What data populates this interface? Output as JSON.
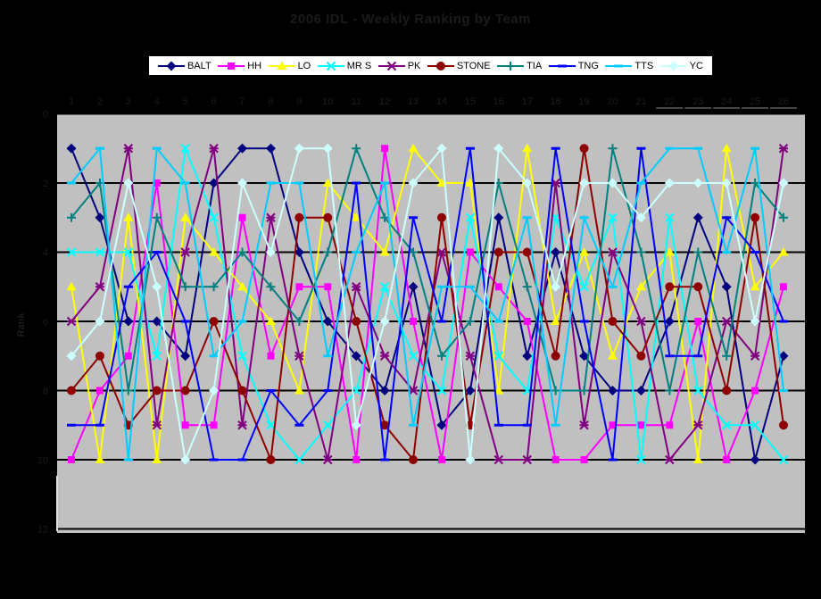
{
  "chart_data": {
    "type": "line",
    "title": "2006 IDL - Weekly Ranking by Team",
    "ylabel": "Rank",
    "x_categories": [
      "1",
      "2",
      "3",
      "4",
      "5",
      "6",
      "7",
      "8",
      "9",
      "10",
      "11",
      "12",
      "13",
      "14",
      "15",
      "16",
      "17",
      "18",
      "19",
      "20",
      "21",
      "22",
      "23",
      "24",
      "25",
      "26"
    ],
    "y_ticks": [
      "0",
      "2",
      "4",
      "6",
      "8",
      "10",
      "12"
    ],
    "ylim": [
      0,
      12
    ],
    "y_axis_reversed": true,
    "grid": true,
    "legend_position": "top",
    "plot_bg_color": "#C0C0C0",
    "gridline_color": "#000000",
    "axis_text_color": "#1b1b1b",
    "series": [
      {
        "name": "BALT",
        "color": "#000080",
        "marker": "diamond",
        "values": [
          1,
          3,
          6,
          6,
          7,
          2,
          1,
          1,
          4,
          6,
          7,
          8,
          5,
          9,
          8,
          3,
          7,
          4,
          7,
          8,
          8,
          6,
          3,
          5,
          10,
          7
        ]
      },
      {
        "name": "HH",
        "color": "#FF00FF",
        "marker": "square",
        "values": [
          10,
          8,
          7,
          2,
          9,
          9,
          3,
          7,
          5,
          5,
          10,
          1,
          6,
          10,
          4,
          5,
          6,
          10,
          10,
          9,
          9,
          9,
          6,
          10,
          8,
          5
        ]
      },
      {
        "name": "LO",
        "color": "#FFFF00",
        "marker": "triangle",
        "values": [
          5,
          10,
          3,
          10,
          3,
          4,
          5,
          6,
          8,
          2,
          3,
          4,
          1,
          2,
          2,
          8,
          1,
          6,
          4,
          7,
          5,
          4,
          10,
          1,
          5,
          4
        ]
      },
      {
        "name": "MR S",
        "color": "#00FFFF",
        "marker": "x",
        "values": [
          4,
          4,
          4,
          7,
          1,
          3,
          7,
          9,
          10,
          9,
          8,
          5,
          7,
          8,
          3,
          7,
          8,
          3,
          5,
          3,
          10,
          3,
          8,
          9,
          9,
          10
        ]
      },
      {
        "name": "PK",
        "color": "#800080",
        "marker": "asterisk",
        "values": [
          6,
          5,
          1,
          9,
          4,
          1,
          9,
          3,
          7,
          10,
          5,
          7,
          8,
          4,
          7,
          10,
          10,
          2,
          9,
          4,
          6,
          10,
          9,
          6,
          7,
          1
        ]
      },
      {
        "name": "STONE",
        "color": "#8E0000",
        "marker": "circle",
        "values": [
          8,
          7,
          9,
          8,
          8,
          6,
          8,
          10,
          3,
          3,
          6,
          9,
          10,
          3,
          9,
          4,
          4,
          7,
          1,
          6,
          7,
          5,
          5,
          8,
          3,
          9
        ]
      },
      {
        "name": "TIA",
        "color": "#008080",
        "marker": "plus",
        "values": [
          3,
          2,
          8,
          3,
          5,
          5,
          4,
          5,
          6,
          4,
          1,
          3,
          4,
          7,
          6,
          2,
          5,
          8,
          8,
          1,
          4,
          8,
          4,
          7,
          2,
          3
        ]
      },
      {
        "name": "TNG",
        "color": "#0000FF",
        "marker": "dash",
        "values": [
          9,
          9,
          5,
          4,
          6,
          10,
          10,
          8,
          9,
          8,
          2,
          10,
          3,
          6,
          1,
          9,
          9,
          1,
          6,
          10,
          1,
          7,
          7,
          3,
          4,
          6
        ]
      },
      {
        "name": "TTS",
        "color": "#00CCFF",
        "marker": "dash",
        "values": [
          2,
          1,
          10,
          1,
          2,
          7,
          6,
          2,
          2,
          7,
          4,
          2,
          9,
          5,
          5,
          6,
          3,
          9,
          3,
          5,
          2,
          1,
          1,
          4,
          1,
          8
        ]
      },
      {
        "name": "YC",
        "color": "#CCFFFF",
        "marker": "diamond",
        "values": [
          7,
          6,
          2,
          5,
          10,
          8,
          2,
          4,
          1,
          1,
          9,
          6,
          2,
          1,
          10,
          1,
          2,
          5,
          2,
          2,
          3,
          2,
          2,
          2,
          6,
          2
        ]
      }
    ]
  }
}
